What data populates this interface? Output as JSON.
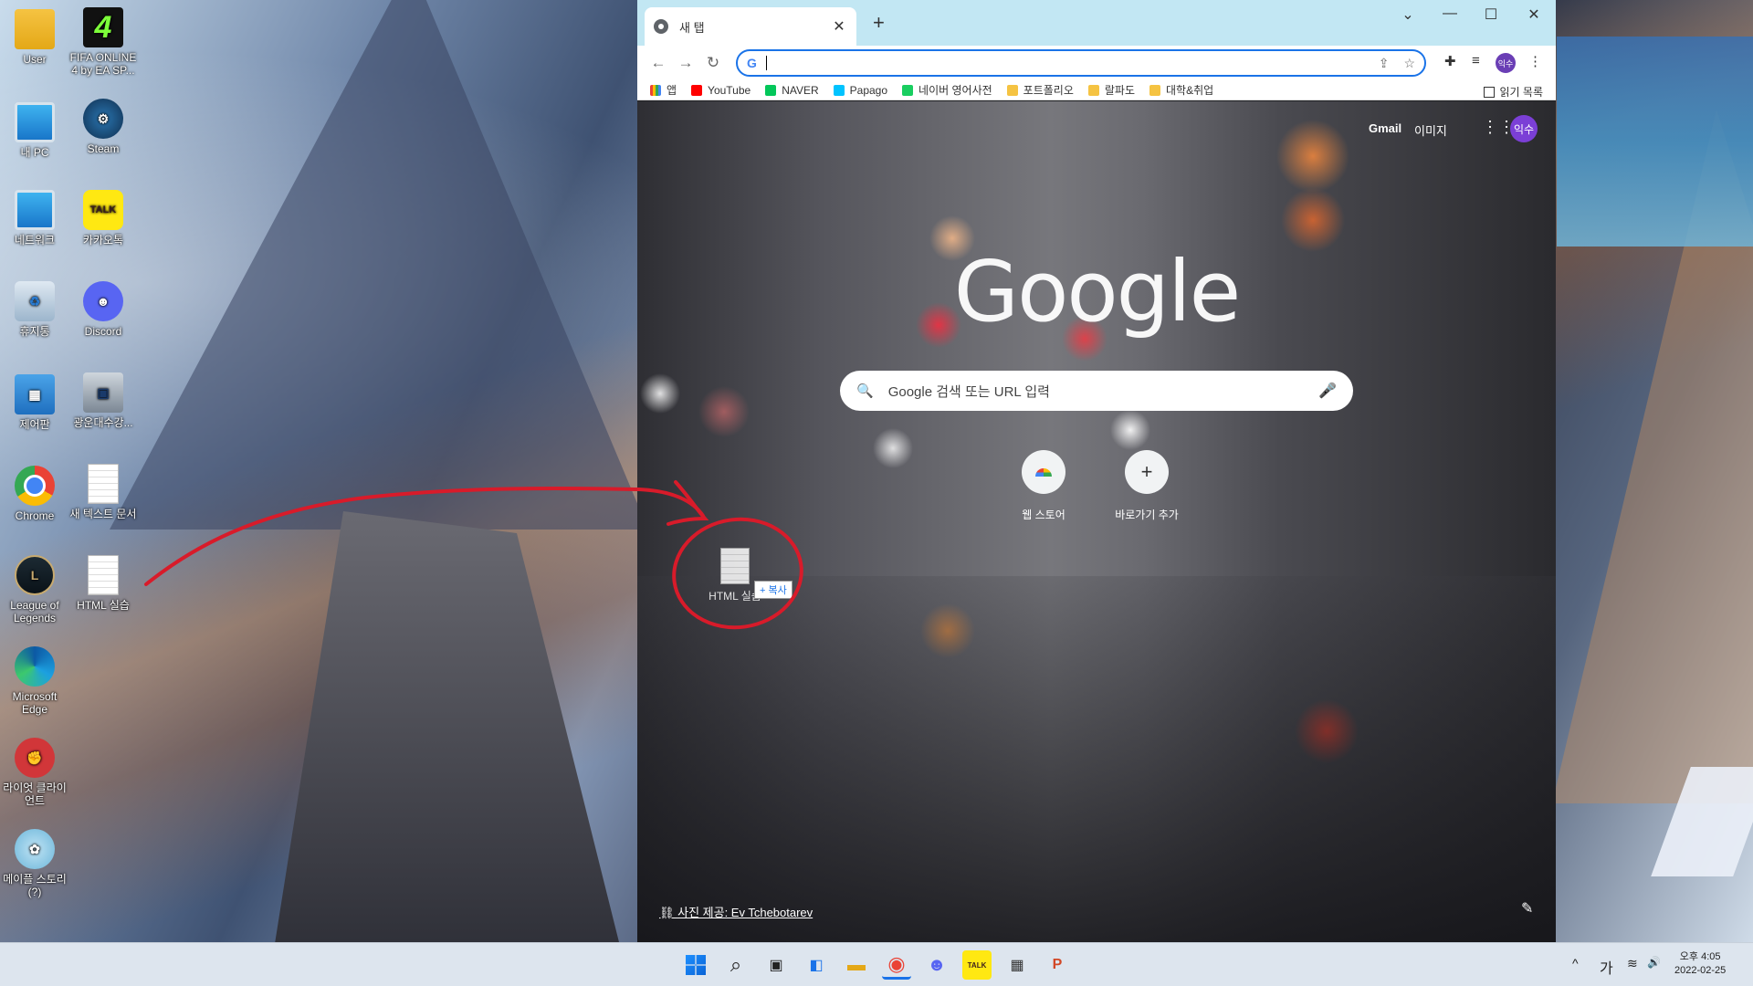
{
  "desktop": {
    "icons": [
      {
        "label": "User",
        "icon": "folder-icon"
      },
      {
        "label": "FIFA ONLINE 4 by EA SP...",
        "icon": "fifa-icon",
        "glyph": "4"
      },
      {
        "label": "내 PC",
        "icon": "monitor-icon"
      },
      {
        "label": "Steam",
        "icon": "steam-icon",
        "glyph": "⚙"
      },
      {
        "label": "네트워크",
        "icon": "network-icon"
      },
      {
        "label": "카카오톡",
        "icon": "kakaotalk-icon",
        "glyph": "TALK"
      },
      {
        "label": "휴지통",
        "icon": "recycle-bin-icon",
        "glyph": "♻"
      },
      {
        "label": "Discord",
        "icon": "discord-icon",
        "glyph": "☻"
      },
      {
        "label": "제어판",
        "icon": "control-panel-icon",
        "glyph": "▦"
      },
      {
        "label": "광운대수강...",
        "icon": "shortcut-pc-icon",
        "glyph": "▣"
      },
      {
        "label": "Chrome",
        "icon": "chrome-icon"
      },
      {
        "label": "새 텍스트 문서",
        "icon": "text-document-icon"
      },
      {
        "label": "League of Legends",
        "icon": "league-icon",
        "glyph": "L"
      },
      {
        "label": "HTML 실습",
        "icon": "html-document-icon"
      },
      {
        "label": "Microsoft Edge",
        "icon": "edge-icon"
      },
      {
        "label": "라이엇 클라이언트",
        "icon": "riot-icon",
        "glyph": "✊"
      },
      {
        "label": "메이플 스토리 (?)",
        "icon": "maple-icon",
        "glyph": "✿"
      }
    ]
  },
  "browser": {
    "tab_title": "새 탭",
    "tab_close": "✕",
    "new_tab": "+",
    "window_controls": {
      "dropdown": "⌄",
      "minimize": "—",
      "maximize": "☐",
      "close": "✕"
    },
    "nav": {
      "back": "←",
      "forward": "→",
      "reload": "↻"
    },
    "omnibox": {
      "g": "G",
      "value": ""
    },
    "profile_short": "익수",
    "bookmarks": [
      {
        "label": "앱",
        "kind": "ap"
      },
      {
        "label": "YouTube",
        "kind": "yt"
      },
      {
        "label": "NAVER",
        "kind": "nv"
      },
      {
        "label": "Papago",
        "kind": "pp"
      },
      {
        "label": "네이버 영어사전",
        "kind": "nd"
      },
      {
        "label": "포트폴리오",
        "kind": "fo"
      },
      {
        "label": "랄파도",
        "kind": "fo"
      },
      {
        "label": "대학&취업",
        "kind": "fo"
      }
    ],
    "reading_list": "읽기 목록"
  },
  "ntp": {
    "gmail": "Gmail",
    "images": "이미지",
    "apps_glyph": "⋮⋮⋮",
    "avatar": "익수",
    "logo": "Google",
    "search_placeholder": "Google 검색 또는 URL 입력",
    "search_icon": "🔍",
    "mic_icon": "🎤",
    "shortcuts": [
      {
        "label": "웹 스토어"
      },
      {
        "label": "바로가기 추가",
        "glyph": "+"
      }
    ],
    "photo_credit": "⛓ 사진 제공: Ev Tchebotarev",
    "edit_glyph": "✎"
  },
  "drag": {
    "label": "HTML 실습",
    "badge": "+ 복사"
  },
  "taskbar": {
    "clock_time": "오후 4:05",
    "clock_date": "2022-02-25",
    "ime": "가",
    "tray_up": "^",
    "tray_net": "≋",
    "tray_vol": "🔊",
    "apps": [
      {
        "name": "start",
        "glyph": ""
      },
      {
        "name": "search",
        "glyph": "⌕"
      },
      {
        "name": "task-view",
        "glyph": "▣"
      },
      {
        "name": "widgets",
        "glyph": "◧"
      },
      {
        "name": "file-explorer",
        "glyph": "▬"
      },
      {
        "name": "chrome",
        "glyph": "◉"
      },
      {
        "name": "discord",
        "glyph": "☻"
      },
      {
        "name": "kakaotalk",
        "glyph": "TALK"
      },
      {
        "name": "calculator",
        "glyph": "▦"
      },
      {
        "name": "powerpoint",
        "glyph": "P"
      }
    ]
  },
  "colors": {
    "annotation": "#d81b2a",
    "accent": "#1a73e8"
  }
}
